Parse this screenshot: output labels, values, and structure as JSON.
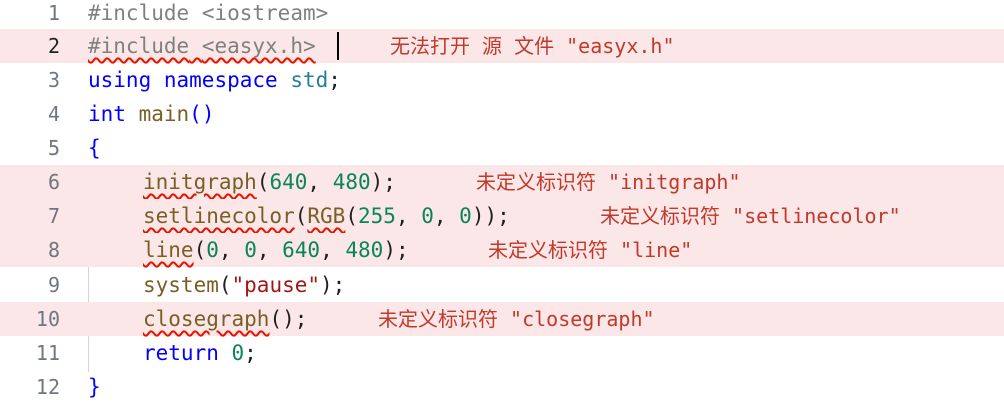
{
  "lines": [
    {
      "number": "1",
      "code": {
        "directive": "#include",
        "target": "<iostream>"
      }
    },
    {
      "number": "2",
      "code": {
        "directive": "#include",
        "target": "<easyx.h>"
      },
      "error": "无法打开 源 文件 \"easyx.h\""
    },
    {
      "number": "3",
      "code": {
        "kw1": "using",
        "kw2": "namespace",
        "ns": "std",
        "semi": ";"
      }
    },
    {
      "number": "4",
      "code": {
        "type": "int",
        "name": "main",
        "parens": "()"
      }
    },
    {
      "number": "5",
      "code": {
        "brace": "{"
      }
    },
    {
      "number": "6",
      "code": {
        "fn": "initgraph",
        "open": "(",
        "a1": "640",
        "sep": ", ",
        "a2": "480",
        "close": ");"
      },
      "error": "未定义标识符 \"initgraph\""
    },
    {
      "number": "7",
      "code": {
        "fn": "setlinecolor",
        "open": "(",
        "inner": "RGB",
        "open2": "(",
        "a1": "255",
        "sep1": ", ",
        "a2": "0",
        "sep2": ", ",
        "a3": "0",
        "close": "));"
      },
      "error": "未定义标识符 \"setlinecolor\""
    },
    {
      "number": "8",
      "code": {
        "fn": "line",
        "open": "(",
        "a1": "0",
        "sep1": ", ",
        "a2": "0",
        "sep2": ", ",
        "a3": "640",
        "sep3": ", ",
        "a4": "480",
        "close": ");"
      },
      "error": "未定义标识符 \"line\""
    },
    {
      "number": "9",
      "code": {
        "fn": "system",
        "open": "(",
        "str": "\"pause\"",
        "close": ");"
      }
    },
    {
      "number": "10",
      "code": {
        "fn": "closegraph",
        "args": "();"
      },
      "error": "未定义标识符 \"closegraph\""
    },
    {
      "number": "11",
      "code": {
        "kw": "return",
        "sp": " ",
        "num": "0",
        "semi": ";"
      }
    },
    {
      "number": "12",
      "code": {
        "brace": "}"
      }
    }
  ],
  "colors": {
    "keyword": "#0000ff",
    "preprocessor": "#808080",
    "function": "#795e26",
    "number": "#098658",
    "string": "#a31515",
    "namespace": "#267f99",
    "error_text": "#c0392b",
    "error_background": "#fbe7e7",
    "squiggle": "#e51400"
  }
}
